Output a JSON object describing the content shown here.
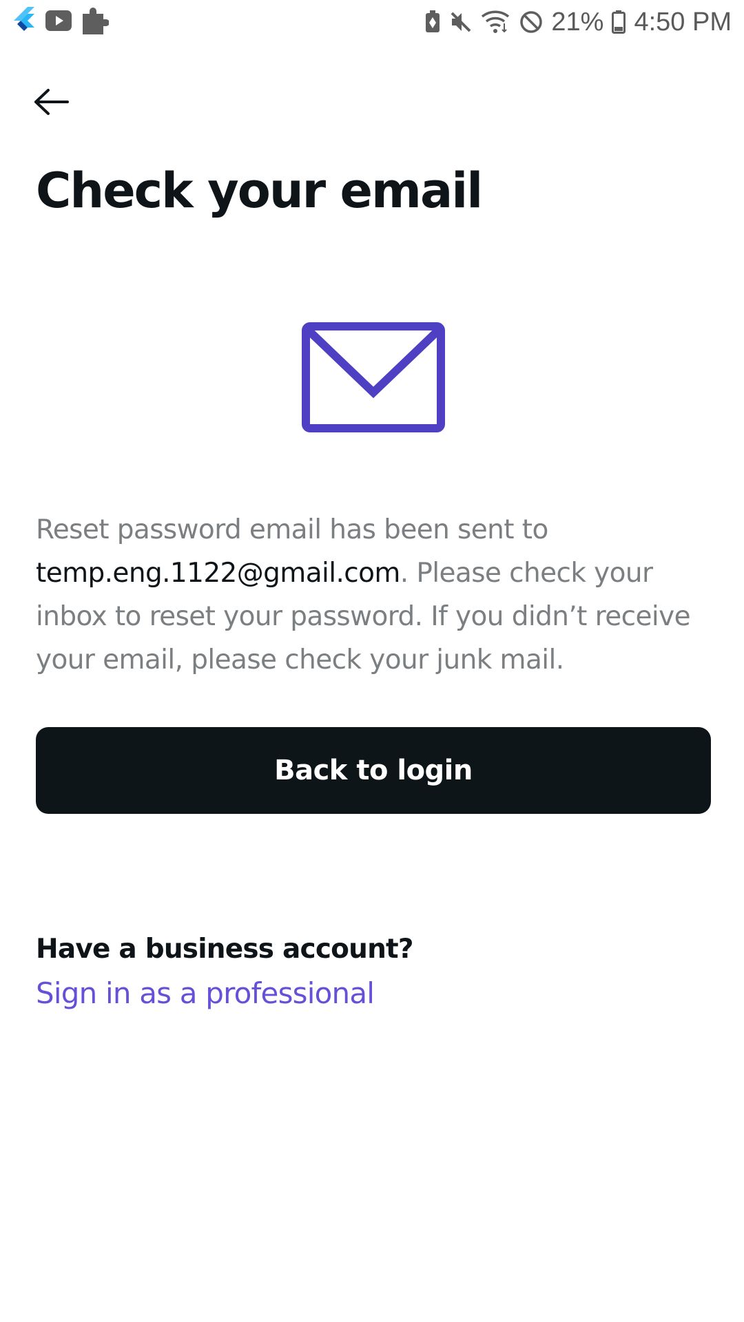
{
  "status_bar": {
    "battery_percent": "21%",
    "time": "4:50 PM",
    "left_icons": [
      "flutter-icon",
      "youtube-icon",
      "puzzle-icon"
    ],
    "right_icons": [
      "battery-saver-icon",
      "mute-icon",
      "wifi-icon",
      "do-not-disturb-icon",
      "battery-icon"
    ]
  },
  "header": {
    "back_icon": "arrow-left-icon",
    "title": "Check your email"
  },
  "illustration": {
    "icon": "mail-icon",
    "color": "#4f3fc3"
  },
  "message": {
    "part1": "Reset password email has been sent to ",
    "email": "temp.eng.1122@gmail.com",
    "part2": ". Please check your inbox to reset your password. If you didn’t receive your email, please check your junk mail."
  },
  "actions": {
    "back_to_login_label": "Back to login"
  },
  "business": {
    "question": "Have a business account?",
    "link_label": "Sign in as a professional",
    "link_color": "#6650d8"
  },
  "colors": {
    "primary_button_bg": "#0d1519",
    "heading_text": "#0e1418",
    "body_text": "#7b7f82"
  }
}
